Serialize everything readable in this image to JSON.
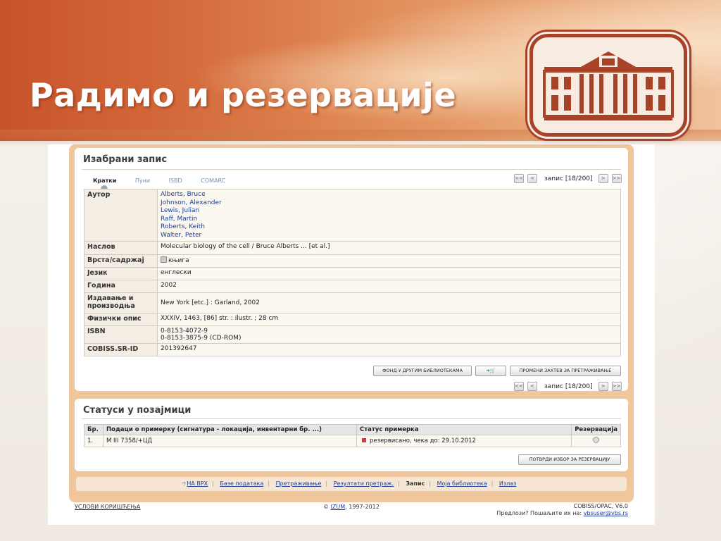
{
  "slide": {
    "title": "Радимо и резервације"
  },
  "record": {
    "heading": "Изабрани запис",
    "tabs": [
      "Кратки",
      "Пуни",
      "ISBD",
      "COMARC"
    ],
    "nav_text": "запис [18/200]",
    "nav_buttons": {
      "first": "<<",
      "prev": "<",
      "next": ">",
      "last": ">>"
    },
    "fields": {
      "author_label": "Аутор",
      "authors": [
        "Alberts, Bruce",
        "Johnson, Alexander",
        "Lewis, Julian",
        "Raff, Martin",
        "Roberts, Keith",
        "Walter, Peter"
      ],
      "title_label": "Наслов",
      "title_value": "Molecular biology of the cell / Bruce Alberts ... [et al.]",
      "type_label": "Врста/садржај",
      "type_value": "књига",
      "lang_label": "Језик",
      "lang_value": "енглески",
      "year_label": "Година",
      "year_value": "2002",
      "pub_label": "Издавање и производња",
      "pub_value": "New York [etc.] : Garland, 2002",
      "phys_label": "Физички опис",
      "phys_value": "XXXIV, 1463, [86] str. : ilustr. ; 28 cm",
      "isbn_label": "ISBN",
      "isbn_values": [
        "0-8153-4072-9",
        "0-8153-3875-9 (CD-ROM)"
      ],
      "cobiss_label": "COBISS.SR-ID",
      "cobiss_value": "201392647"
    },
    "buttons": {
      "holdings": "ФОНД У ДРУГИМ БИБЛИОТЕКАМА",
      "basket": "➜🛒",
      "change_request": "ПРОМЕНИ ЗАХТЕВ ЗА ПРЕТРАЖИВАЊЕ"
    }
  },
  "loan": {
    "heading": "Статуси у позајмици",
    "columns": [
      "Бр.",
      "Подаци о примерку (сигнатура - локација, инвентарни бр. ...)",
      "Статус примерка",
      "Резервација"
    ],
    "rows": [
      {
        "no": "1.",
        "copy": "M III 7358/+ЦД",
        "status": "резервисано, чека до: 29.10.2012"
      }
    ],
    "confirm_button": "ПОТВРДИ ИЗБОР ЗА РЕЗЕРВАЦИЈУ"
  },
  "footer_nav": {
    "top": "НА ВРХ",
    "items": [
      "Базе података",
      "Претраживање",
      "Резултати претраж."
    ],
    "current": "Запис",
    "items_after": [
      "Моја библиотека",
      "Излаз"
    ]
  },
  "bottom": {
    "terms": "УСЛОВИ КОРИШЋЕЊА",
    "copyright_prefix": "©",
    "izum": "IZUM",
    "years": ", 1997-2012",
    "version": "COBISS/OPAC, V6.0",
    "suggest": "Предлози? Пошаљите их на:",
    "email": "vbsuser@vbs.rs"
  },
  "colors": {
    "banner": "#d46a3b",
    "panel": "#f0c79d",
    "link": "#1b3d9a",
    "status_red": "#d23a3a"
  }
}
